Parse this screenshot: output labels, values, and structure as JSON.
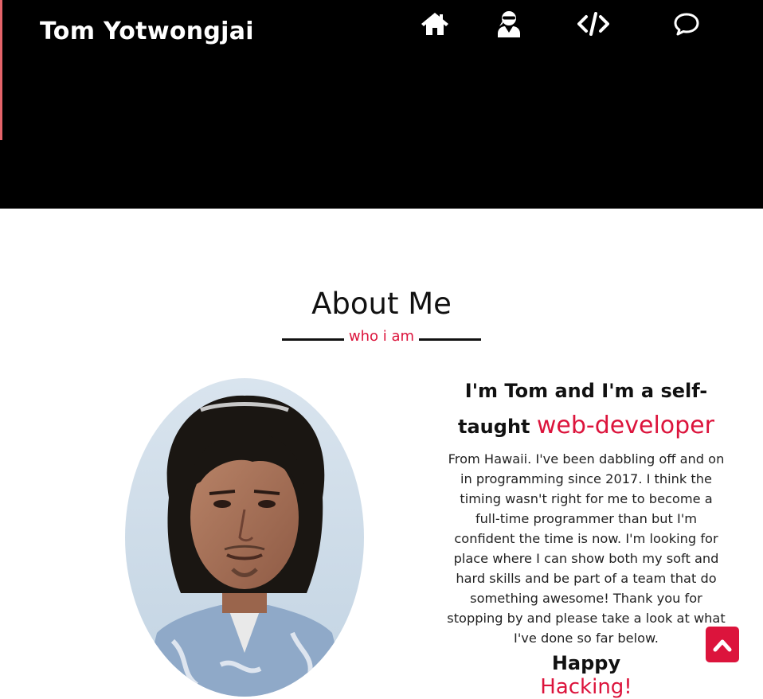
{
  "header": {
    "brand": "Tom Yotwongjai",
    "nav": [
      {
        "icon": "home-icon"
      },
      {
        "icon": "user-ninja-icon"
      },
      {
        "icon": "code-icon"
      },
      {
        "icon": "chat-bubble-icon"
      }
    ]
  },
  "about": {
    "title": "About Me",
    "subtitle": "who i am",
    "intro_prefix": "I'm Tom and I'm a self-taught",
    "intro_accent": "web-developer",
    "body": "From Hawaii. I've been dabbling off and on in programming since 2017. I think the timing wasn't right for me to become a full-time programmer than but I'm confident the time is now. I'm looking for place where I can show both my soft and hard skills and be part of a team that do something awesome! Thank you for stopping by and please take a look at what I've done so far below.",
    "closing": "Happy",
    "closing_accent": "Hacking!"
  },
  "colors": {
    "accent": "#dc143c",
    "header_bg": "#000000",
    "header_stripe": "#e5646a"
  },
  "scroll_top": {
    "icon": "chevron-up-icon"
  }
}
